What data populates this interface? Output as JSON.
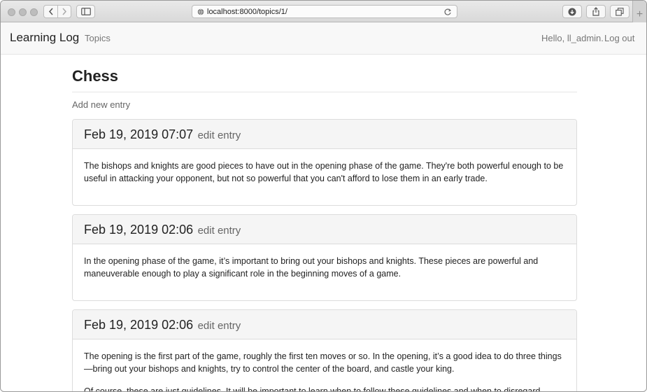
{
  "browser": {
    "url": "localhost:8000/topics/1/"
  },
  "navbar": {
    "brand": "Learning Log",
    "topics_link": "Topics",
    "greeting": "Hello, ll_admin.",
    "logout_link": "Log out"
  },
  "page": {
    "title": "Chess",
    "add_entry_link": "Add new entry"
  },
  "entries": [
    {
      "date": "Feb 19, 2019 07:07",
      "edit_label": "edit entry",
      "paragraphs": [
        "The bishops and knights are good pieces to have out in the opening phase of the game. They're both powerful enough to be useful in attacking your opponent, but not so powerful that you can't afford to lose them in an early trade."
      ]
    },
    {
      "date": "Feb 19, 2019 02:06",
      "edit_label": "edit entry",
      "paragraphs": [
        "In the opening phase of the game, it’s important to bring out your bishops and knights. These pieces are powerful and maneuverable enough to play a significant role in the beginning moves of a game."
      ]
    },
    {
      "date": "Feb 19, 2019 02:06",
      "edit_label": "edit entry",
      "paragraphs": [
        "The opening is the first part of the game, roughly the first ten moves or so. In the opening, it’s a good idea to do three things—bring out your bishops and knights, try to control the center of the board, and castle your king.",
        "Of course, these are just guidelines. It will be important to learn when to follow these guidelines and when to disregard"
      ]
    }
  ]
}
